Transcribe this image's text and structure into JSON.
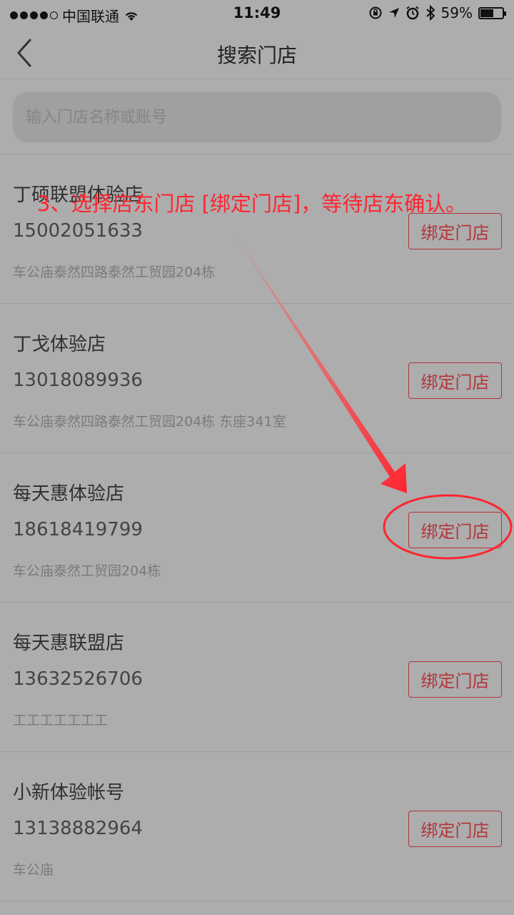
{
  "status_bar": {
    "carrier": "中国联通",
    "time": "11:49",
    "battery": "59%",
    "battery_level": 0.59
  },
  "nav": {
    "title": "搜索门店",
    "back_icon": "chevron-left-icon"
  },
  "search": {
    "placeholder": "输入门店名称或账号",
    "value": ""
  },
  "stores": [
    {
      "name": "丁硕联盟体验店",
      "phone": "15002051633",
      "address": "车公庙泰然四路泰然工贸园204栋",
      "button": "绑定门店"
    },
    {
      "name": "丁戈体验店",
      "phone": "13018089936",
      "address": "车公庙泰然四路泰然工贸园204栋 东座341室",
      "button": "绑定门店"
    },
    {
      "name": "每天惠体验店",
      "phone": "18618419799",
      "address": "车公庙泰然工贸园204栋",
      "button": "绑定门店"
    },
    {
      "name": "每天惠联盟店",
      "phone": "13632526706",
      "address": "工工工工工工工",
      "button": "绑定门店"
    },
    {
      "name": "小新体验帐号",
      "phone": "13138882964",
      "address": "车公庙",
      "button": "绑定门店"
    }
  ],
  "annotation": {
    "text": "3、选择店东门店 [绑定门店]，等待店东确认。",
    "color": "#ff2530"
  },
  "colors": {
    "accent": "#b4353a",
    "overlay_bg": "#adadad"
  }
}
